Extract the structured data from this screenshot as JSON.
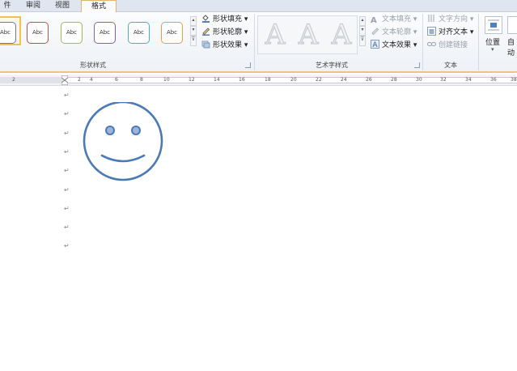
{
  "tabs": [
    {
      "label": "件",
      "active": false
    },
    {
      "label": "审阅",
      "active": false
    },
    {
      "label": "视图",
      "active": false
    },
    {
      "label": "格式",
      "active": true
    }
  ],
  "shape_styles": {
    "group_label": "形状样式",
    "gallery": [
      {
        "label": "Abc",
        "color": "#4f81bd",
        "selected": true
      },
      {
        "label": "Abc",
        "color": "#c0504d",
        "selected": false
      },
      {
        "label": "Abc",
        "color": "#9bbb59",
        "selected": false
      },
      {
        "label": "Abc",
        "color": "#8064a2",
        "selected": false
      },
      {
        "label": "Abc",
        "color": "#4bacc6",
        "selected": false
      },
      {
        "label": "Abc",
        "color": "#f79646",
        "selected": false
      }
    ],
    "fill_label": "形状填充",
    "outline_label": "形状轮廓",
    "effects_label": "形状效果"
  },
  "wordart_styles": {
    "group_label": "艺术字样式",
    "samples": [
      "A",
      "A",
      "A"
    ],
    "text_fill_label": "文本填充",
    "text_outline_label": "文本轮廓",
    "text_effects_label": "文本效果"
  },
  "text_group": {
    "group_label": "文本",
    "direction_label": "文字方向",
    "align_label": "对齐文本",
    "link_label": "创建链接"
  },
  "arrange": {
    "position_label": "位置",
    "wrap_label": "自动"
  },
  "ruler": {
    "numbers": [
      "2",
      "2",
      "4",
      "6",
      "8",
      "10",
      "12",
      "14",
      "16",
      "18",
      "20",
      "22",
      "24",
      "26",
      "28",
      "30",
      "32",
      "34",
      "36",
      "38"
    ]
  },
  "document": {
    "paragraph_mark": "↵",
    "paragraph_count": 9,
    "shape": {
      "name": "smiley face",
      "stroke_color": "#4a7ab5",
      "eye_fill": "#9db3d9"
    }
  },
  "colors": {
    "accent_tab_border": "#e2b56c",
    "ribbon_bottom": "#f0c27d",
    "selection": "#f2c14e"
  }
}
